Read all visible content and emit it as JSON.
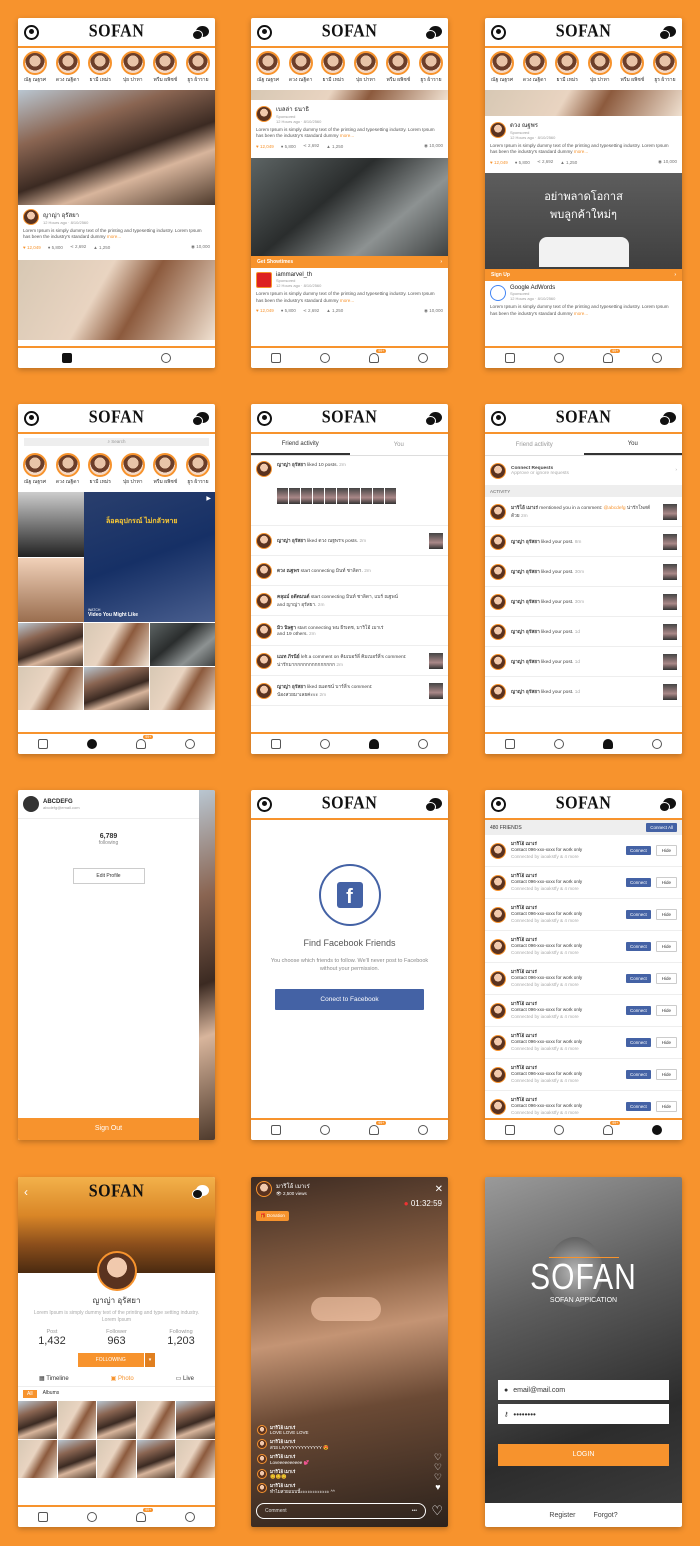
{
  "brand": "SOFAN",
  "stories": [
    "ณัฐ ณฐรศ",
    "ดวง ณฐิดา",
    "ยามี เหม่ร",
    "ปุย ปาทา",
    "พรีม ผพิชช์",
    "ยูร ผ้าราย"
  ],
  "screen1": {
    "post": {
      "name": "ญาญ่า อุรัสยา",
      "meta": "12 Hours ago · 8/10/2560",
      "text": "Lorem Ipsum is simply dummy text of the printing and typesetting industry. Lorem Ipsum has been the industry's standard dummy ",
      "more": "more...",
      "likes": "12,049",
      "comments": "5,800",
      "shares": "2,692",
      "views_a": "1,250",
      "views_b": "10,000"
    }
  },
  "screen2": {
    "post1": {
      "name": "เบลล่า ธนาธิ",
      "sponsored": "Sponsored",
      "meta": "12 Hours ago · 8/10/2560",
      "text": "Lorem Ipsum is simply dummy text of the printing and typesetting industry. Lorem Ipsum has been the industry's standard dummy ",
      "more": "more...",
      "likes": "12,049",
      "comments": "5,800",
      "shares": "2,692",
      "views_a": "1,250",
      "views_b": "10,000"
    },
    "banner": "Get Showtimes",
    "banner_arrow": "›",
    "post2": {
      "name": "iammarvel_th",
      "sponsored": "Sponsored",
      "meta": "12 Hours ago · 8/10/2560",
      "text": "Lorem Ipsum is simply dummy text of the printing and typesetting industry. Lorem Ipsum has been the industry's standard dummy ",
      "more": "more...",
      "likes": "12,049",
      "comments": "5,800",
      "shares": "2,692",
      "views_a": "1,250",
      "views_b": "10,000"
    }
  },
  "screen3": {
    "post1": {
      "name": "ดวง ณฐพร",
      "sponsored": "Sponsored",
      "meta": "12 Hours ago · 8/10/2560",
      "text": "Lorem Ipsum is simply dummy text of the printing and typesetting industry. Lorem Ipsum has been the industry's standard dummy ",
      "more": "more...",
      "likes": "12,049",
      "comments": "5,800",
      "shares": "2,692",
      "views_a": "1,250",
      "views_b": "10,000"
    },
    "ad_line1": "อย่าพลาดโอกาส",
    "ad_line2": "พบลูกค้าใหม่ๆ",
    "banner": "Sign Up",
    "banner_arrow": "›",
    "post2": {
      "name": "Google AdWords",
      "sponsored": "Sponsored",
      "meta": "12 Hours ago · 8/10/2560",
      "text": "Lorem Ipsum is simply dummy text of the printing and typesetting industry. Lorem Ipsum has been the industry's standard dummy ",
      "more": "more..."
    }
  },
  "screen4": {
    "search_placeholder": "Search",
    "ad_text": "ล็อคอุปกรณ์ ไม่กลัวหาย",
    "watch_small": "WATCH",
    "watch": "Video You Might Like"
  },
  "screen5": {
    "tabs": [
      "Friend activity",
      "You"
    ],
    "rows": [
      {
        "name": "ญาญ่า อุรัสยา",
        "action": "liked 10 posts.",
        "time": "2m"
      },
      {
        "name": "ญาญ่า อุรัสยา",
        "action": "liked ดวง ณฐพร's posts.",
        "time": "2m"
      },
      {
        "name": "ดวง ณฐพร",
        "action": "start connecting มินท์ ชาลิดา.",
        "time": "2m"
      },
      {
        "name": "คลุมม์ อดีตมนต์",
        "action": "start connecting มินท์ ชาลิดา, แบร์ ณฐพน์",
        "extra": "and ญาญ่า อุรัสยา.",
        "time": "2m"
      },
      {
        "name": "มิว นิษฐา",
        "action": "start connecting พน ธีรเดช, มาริโอ้ เมาเร่",
        "extra": "and 19 others.",
        "time": "2m"
      },
      {
        "name": "แมท ภีรนีย์",
        "action": "left a comment on คิมเบอร์ลี่ คิมเบอร์ลี่'s comment:",
        "extra": "น่ารักมากกกกกกกกกกกกกก",
        "time": "2m"
      },
      {
        "name": "ญาญ่า อุรัสยา",
        "action": "liked ณเดชน์ บาร์ลี่'s comment:",
        "extra": "น้องสวยมาเลยค่ะะะ",
        "time": "2m"
      }
    ]
  },
  "screen6": {
    "tabs": [
      "Friend activity",
      "You"
    ],
    "requests_title": "Connect Requests",
    "requests_sub": "Approve or ignore requests",
    "activity_label": "ACTIVITY",
    "first": {
      "name": "มาริโอ้ เมาเร่",
      "action": "mentioned you in a comment: ",
      "mention": "@abcdefg",
      "tail": " น่ารักโพสต์ด้วย",
      "time": "2m"
    },
    "rows": [
      {
        "name": "ญาญ่า อุรัสยา",
        "action": "liked your post.",
        "time": "8m"
      },
      {
        "name": "ญาญ่า อุรัสยา",
        "action": "liked your post.",
        "time": "30m"
      },
      {
        "name": "ญาญ่า อุรัสยา",
        "action": "liked your post.",
        "time": "30m"
      },
      {
        "name": "ญาญ่า อุรัสยา",
        "action": "liked your post.",
        "time": "1d"
      },
      {
        "name": "ญาญ่า อุรัสยา",
        "action": "liked your post.",
        "time": "1d"
      },
      {
        "name": "ญาญ่า อุรัสยา",
        "action": "liked your post.",
        "time": "1d"
      }
    ]
  },
  "screen7": {
    "user": "ABCDEFG",
    "email": "abcdefg@email.com",
    "count": "6,789",
    "count_label": "following",
    "edit": "Edit Profile",
    "signout": "Sign Out"
  },
  "screen8": {
    "title": "Find Facebook Friends",
    "desc": "You choose which friends to follow. We'll never post to Facebook without your permission.",
    "button": "Conect to Facebook"
  },
  "screen9": {
    "count_label": "480 FRIENDS",
    "connect_all": "Connect All",
    "row": {
      "name": "มาริโอ้ เมาเร่",
      "line1": "Contact 096-xxx-xxxx for work only",
      "line2": "Connected by iaoakstfy & 4 more",
      "connect": "Connect",
      "hide": "Hide"
    },
    "rows": 9
  },
  "screen10": {
    "name": "ญาญ่า อุรัสยา",
    "bio": "Lorem Ipsum is simply dummy text of the printing and type setting industry. Lorem Ipsum",
    "stats": [
      {
        "label": "Post",
        "value": "1,432"
      },
      {
        "label": "Follower",
        "value": "963"
      },
      {
        "label": "Following",
        "value": "1,203"
      }
    ],
    "following": "FOLLOWING",
    "tabs": [
      "Timeline",
      "Photo",
      "Live"
    ],
    "subtabs": [
      "All",
      "Albums"
    ]
  },
  "screen11": {
    "name": "มาริโอ้ เมาเร่",
    "views": "2,500 views",
    "timer": "01:32:59",
    "donation": "Donation",
    "comments": [
      {
        "n": "มาริโอ้ เมาเร่",
        "t": "LOVE LOVE LOVE"
      },
      {
        "n": "มาริโอ้ เมาเร่",
        "t": "สวย LIVYYYYYYYYYYYY 😍"
      },
      {
        "n": "มาริโอ้ เมาเร่",
        "t": "Loveeeeeeeeee 💕"
      },
      {
        "n": "มาริโอ้ เมาเร่",
        "t": "😊😊😊"
      },
      {
        "n": "มาริโอ้ เมาเร่",
        "t": "ทำไมสวยแบบนี้ะะะะะะะะะะะะ ^^"
      }
    ],
    "comment_placeholder": "Comment"
  },
  "screen12": {
    "brand": "SOFAN",
    "subtitle": "SOFAN APPICATION",
    "email": "email@mail.com",
    "password": "••••••••",
    "login": "LOGIN",
    "register": "Register",
    "forgot": "Forgot?"
  },
  "colors": {
    "accent": "#F7932D",
    "facebook": "#4462a5"
  }
}
